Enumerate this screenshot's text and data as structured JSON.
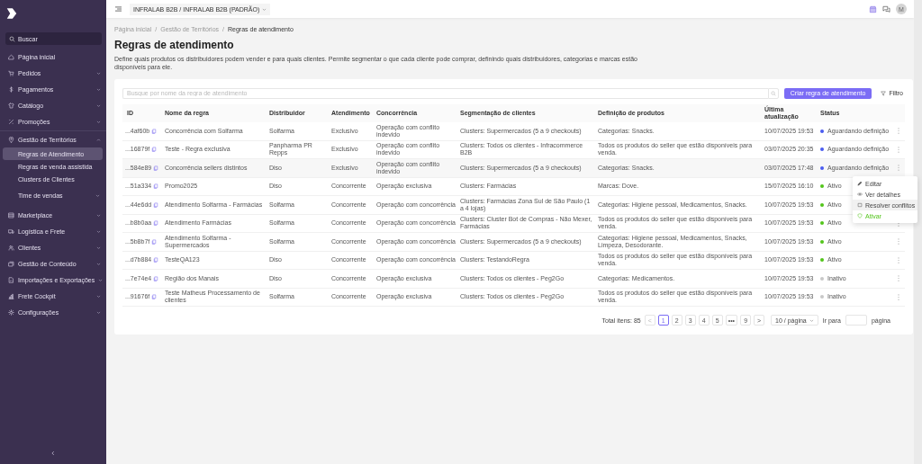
{
  "sidebar": {
    "search": {
      "placeholder": "Buscar"
    },
    "items": [
      {
        "label": "Página inicial",
        "kind": "link"
      },
      {
        "label": "Pedidos",
        "kind": "group",
        "expanded": false
      },
      {
        "label": "Pagamentos",
        "kind": "group",
        "expanded": false
      },
      {
        "label": "Catálogo",
        "kind": "group",
        "expanded": false
      },
      {
        "label": "Promoções",
        "kind": "group",
        "expanded": false
      },
      {
        "label": "Gestão de Territórios",
        "kind": "group",
        "expanded": true,
        "children": [
          {
            "label": "Regras de Atendimento",
            "kind": "link",
            "selected": true
          },
          {
            "label": "Regras de venda assistida",
            "kind": "link",
            "selected": false
          },
          {
            "label": "Clusters de Clientes",
            "kind": "link",
            "selected": false
          },
          {
            "label": "Time de vendas",
            "kind": "group",
            "selected": false,
            "expanded": false
          }
        ]
      },
      {
        "label": "Marketplace",
        "kind": "group",
        "expanded": false
      },
      {
        "label": "Logística e Frete",
        "kind": "group",
        "expanded": false
      },
      {
        "label": "Clientes",
        "kind": "group",
        "expanded": false
      },
      {
        "label": "Gestão de Conteúdo",
        "kind": "group",
        "expanded": false
      },
      {
        "label": "Importações e Exportações",
        "kind": "group",
        "expanded": false
      },
      {
        "label": "Frete Cockpit",
        "kind": "group",
        "expanded": false
      },
      {
        "label": "Configurações",
        "kind": "group",
        "expanded": false
      }
    ]
  },
  "header": {
    "workspace": "INFRALAB B2B / INFRALAB B2B (PADRÃO)",
    "avatar": "M"
  },
  "breadcrumb": {
    "items": [
      "Página inicial",
      "Gestão de Territórios",
      "Regras de atendimento"
    ],
    "separator": "/"
  },
  "page": {
    "title": "Regras de atendimento",
    "description": "Define quais produtos os distribuidores podem vender e para quais clientes. Permite segmentar o que cada cliente pode comprar, definindo quais distribuidores, categorias e marcas estão disponíveis para ele."
  },
  "toolbar": {
    "search": {
      "placeholder": "Busque por nome da regra de atendimento"
    },
    "create_button": "Criar regra de atendimento",
    "filter_button": "Filtro"
  },
  "table": {
    "columns": [
      "ID",
      "Nome da regra",
      "Distribuidor",
      "Atendimento",
      "Concorrência",
      "Segmentação de clientes",
      "Definição de produtos",
      "Última atualização",
      "Status"
    ],
    "rows": [
      {
        "id": "...4af60b",
        "name": "Concorrência com Solfarma",
        "distributor": "Solfarma",
        "service": "Exclusivo",
        "competition": "Operação com conflito indevido",
        "segmentation": "Clusters: Supermercados (5 a 9 checkouts)",
        "products": "Categorias: Snacks.",
        "updated": "10/07/2025 19:53",
        "status": {
          "label": "Aguardando definição",
          "color": "#4a5cf0"
        },
        "highlighted": false
      },
      {
        "id": "...16879f",
        "name": "Teste - Regra exclusiva",
        "distributor": "Panpharma PR Repps",
        "service": "Exclusivo",
        "competition": "Operação com conflito indevido",
        "segmentation": "Clusters: Todos os clientes - Infracommerce B2B",
        "products": "Todos os produtos do seller que estão disponíveis para venda.",
        "updated": "03/07/2025 20:35",
        "status": {
          "label": "Aguardando definição",
          "color": "#4a5cf0"
        },
        "highlighted": false
      },
      {
        "id": "...584e89",
        "name": "Concorrência sellers distintos",
        "distributor": "Diso",
        "service": "Exclusivo",
        "competition": "Operação com conflito indevido",
        "segmentation": "Clusters: Supermercados (5 a 9 checkouts)",
        "products": "Categorias: Snacks.",
        "updated": "03/07/2025 17:48",
        "status": {
          "label": "Aguardando definição",
          "color": "#4a5cf0"
        },
        "highlighted": true
      },
      {
        "id": "...51a334",
        "name": "Promo2025",
        "distributor": "Diso",
        "service": "Concorrente",
        "competition": "Operação exclusiva",
        "segmentation": "Clusters: Farmácias",
        "products": "Marcas: Dove.",
        "updated": "15/07/2025 16:10",
        "status": {
          "label": "Ativo",
          "color": "#52c41a"
        },
        "highlighted": false
      },
      {
        "id": "...44e6dd",
        "name": "Atendimento Solfarma - Farmácias",
        "distributor": "Solfarma",
        "service": "Concorrente",
        "competition": "Operação com concorrência",
        "segmentation": "Clusters: Farmácias Zona Sul de São Paulo (1 a 4 lojas)",
        "products": "Categorias: Higiene pessoal, Medicamentos, Snacks.",
        "updated": "10/07/2025 19:53",
        "status": {
          "label": "Ativo",
          "color": "#52c41a"
        },
        "highlighted": false
      },
      {
        "id": "...b8b0aa",
        "name": "Atendimento Farmácias",
        "distributor": "Solfarma",
        "service": "Concorrente",
        "competition": "Operação com concorrência",
        "segmentation": "Clusters: Cluster Bot de Compras - Não Mexer, Farmácias",
        "products": "Todos os produtos do seller que estão disponíveis para venda.",
        "updated": "10/07/2025 19:53",
        "status": {
          "label": "Ativo",
          "color": "#52c41a"
        },
        "highlighted": false
      },
      {
        "id": "...5b8b7f",
        "name": "Atendimento Solfarma - Supermercados",
        "distributor": "Solfarma",
        "service": "Concorrente",
        "competition": "Operação com concorrência",
        "segmentation": "Clusters: Supermercados (5 a 9 checkouts)",
        "products": "Categorias: Higiene pessoal, Medicamentos, Snacks, Limpeza, Desodorante.",
        "updated": "10/07/2025 19:53",
        "status": {
          "label": "Ativo",
          "color": "#52c41a"
        },
        "highlighted": false
      },
      {
        "id": "...d7b884",
        "name": "TesteQA123",
        "distributor": "Diso",
        "service": "Concorrente",
        "competition": "Operação com concorrência",
        "segmentation": "Clusters: TestandoRegra",
        "products": "Todos os produtos do seller que estão disponíveis para venda.",
        "updated": "10/07/2025 19:53",
        "status": {
          "label": "Ativo",
          "color": "#52c41a"
        },
        "highlighted": false
      },
      {
        "id": "...7e74e4",
        "name": "Região dos Manais",
        "distributor": "Diso",
        "service": "Concorrente",
        "competition": "Operação exclusiva",
        "segmentation": "Clusters: Todos os clientes - Peg2Go",
        "products": "Categorias: Medicamentos.",
        "updated": "10/07/2025 19:53",
        "status": {
          "label": "Inativo",
          "color": "#c8c8c8"
        },
        "highlighted": false
      },
      {
        "id": "...91676f",
        "name": "Teste Matheus Processamento de clientes",
        "distributor": "Solfarma",
        "service": "Concorrente",
        "competition": "Operação exclusiva",
        "segmentation": "Clusters: Todos os clientes - Peg2Go",
        "products": "Todos os produtos do seller que estão disponíveis para venda.",
        "updated": "10/07/2025 19:53",
        "status": {
          "label": "Inativo",
          "color": "#c8c8c8"
        },
        "highlighted": false
      }
    ]
  },
  "row_menu": {
    "items": [
      {
        "label": "Editar",
        "kind": "default",
        "highlighted": false
      },
      {
        "label": "Ver detalhes",
        "kind": "default",
        "highlighted": false
      },
      {
        "label": "Resolver conflitos",
        "kind": "default",
        "highlighted": true
      },
      {
        "label": "Ativar",
        "kind": "success",
        "highlighted": false
      }
    ]
  },
  "pagination": {
    "total": "Total itens: 85",
    "prev": "<",
    "pages": [
      {
        "label": "1",
        "selected": true
      },
      {
        "label": "2",
        "selected": false
      },
      {
        "label": "3",
        "selected": false
      },
      {
        "label": "4",
        "selected": false
      },
      {
        "label": "5",
        "selected": false
      },
      {
        "label": "•••",
        "selected": false
      },
      {
        "label": "9",
        "selected": false
      }
    ],
    "next": ">",
    "page_size": "10 / página",
    "goto_label": "Ir para",
    "goto_suffix": "página"
  }
}
